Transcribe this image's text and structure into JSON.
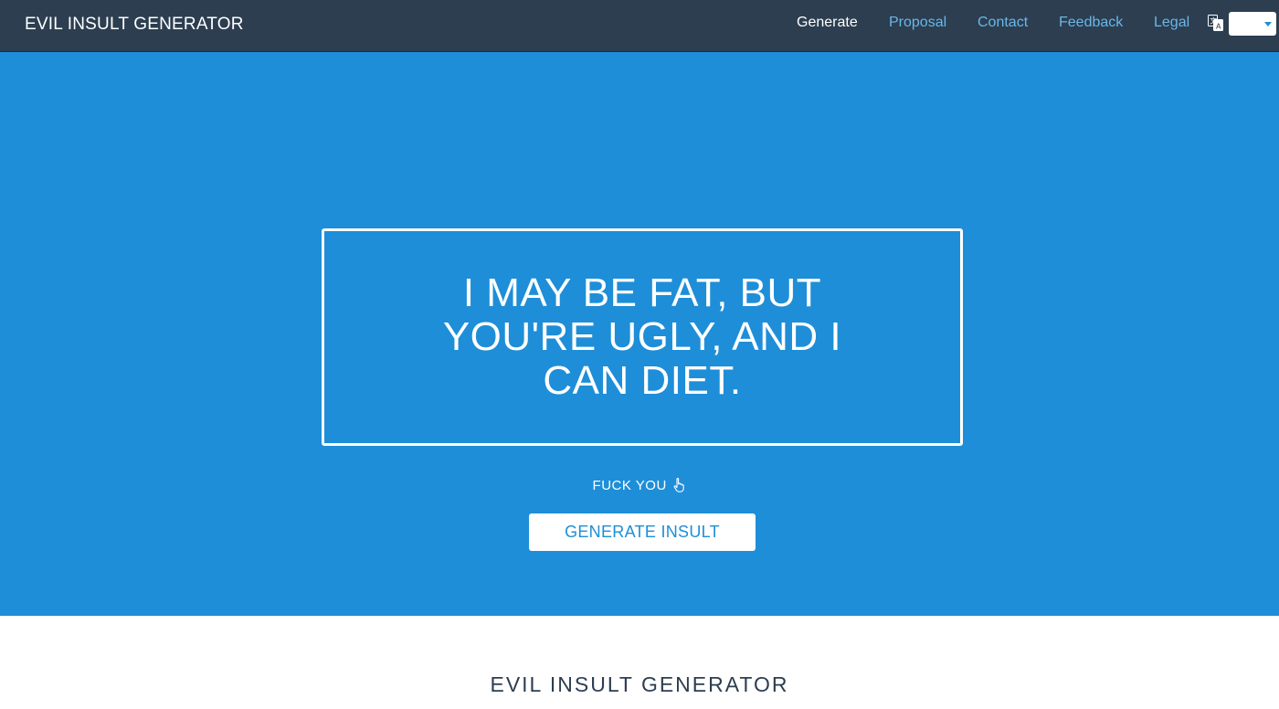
{
  "navbar": {
    "brand": "EVIL INSULT GENERATOR",
    "links": [
      {
        "label": "Generate",
        "active": true
      },
      {
        "label": "Proposal",
        "active": false
      },
      {
        "label": "Contact",
        "active": false
      },
      {
        "label": "Feedback",
        "active": false
      },
      {
        "label": "Legal",
        "active": false
      }
    ],
    "translate_icon": "translate-icon",
    "language_select": {
      "value": "",
      "icon": "caret-down-icon"
    }
  },
  "hero": {
    "insult": "I MAY BE FAT, BUT YOU'RE UGLY, AND I CAN DIET.",
    "fuck_you_label": "FUCK YOU",
    "fuck_you_icon": "pointing-hand-icon",
    "generate_button": "GENERATE INSULT"
  },
  "section": {
    "title": "EVIL INSULT GENERATOR"
  },
  "colors": {
    "navbar_bg": "#2c3e50",
    "hero_bg": "#1e8ed8",
    "link": "#6ab7e8",
    "active_link": "#ffffff"
  }
}
